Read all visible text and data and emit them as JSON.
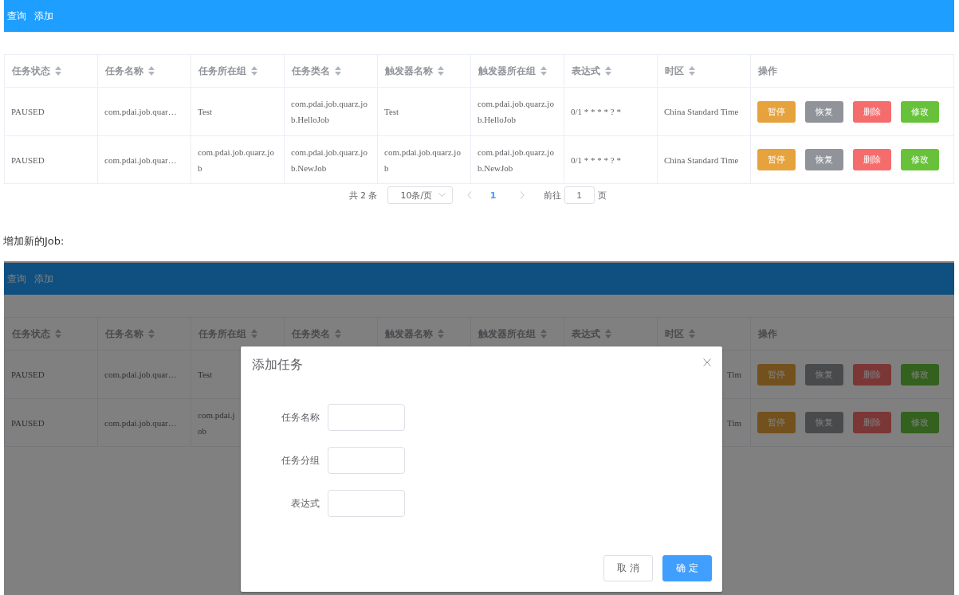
{
  "top_screen": {
    "nav": [
      {
        "label": "查询"
      },
      {
        "label": "添加"
      }
    ],
    "table": {
      "columns": [
        {
          "label": "任务状态",
          "sortable": true
        },
        {
          "label": "任务名称",
          "sortable": true
        },
        {
          "label": "任务所在组",
          "sortable": true
        },
        {
          "label": "任务类名",
          "sortable": true
        },
        {
          "label": "触发器名称",
          "sortable": true
        },
        {
          "label": "触发器所在组",
          "sortable": true
        },
        {
          "label": "表达式",
          "sortable": true
        },
        {
          "label": "时区",
          "sortable": true
        },
        {
          "label": "操作",
          "sortable": false
        }
      ],
      "rows": [
        {
          "cells": [
            "PAUSED",
            "com.pdai.job.quar…",
            "Test",
            "com.pdai.job.quarz.job.HelloJob",
            "Test",
            "com.pdai.job.quarz.job.HelloJob",
            "0/1 * * * * ? *",
            "China Standard Time"
          ],
          "actions": [
            {
              "label": "暂停",
              "kind": "warning"
            },
            {
              "label": "恢复",
              "kind": "info"
            },
            {
              "label": "删除",
              "kind": "danger"
            },
            {
              "label": "修改",
              "kind": "success"
            }
          ]
        },
        {
          "cells": [
            "PAUSED",
            "com.pdai.job.quar…",
            "com.pdai.job.quarz.job",
            "com.pdai.job.quarz.job.NewJob",
            "com.pdai.job.quarz.job",
            "com.pdai.job.quarz.job.NewJob",
            "0/1 * * * * ? *",
            "China Standard Time"
          ],
          "actions": [
            {
              "label": "暂停",
              "kind": "warning"
            },
            {
              "label": "恢复",
              "kind": "info"
            },
            {
              "label": "删除",
              "kind": "danger"
            },
            {
              "label": "修改",
              "kind": "success"
            }
          ]
        }
      ]
    },
    "pagination": {
      "total": "共 2 条",
      "page_size": "10条/页",
      "pages": [
        {
          "label": "1",
          "selected": true
        }
      ],
      "goto_label": "前往",
      "goto_value": "1",
      "goto_suffix": "页"
    }
  },
  "caption": "增加新的Job:",
  "bottom_screen": {
    "nav": [
      {
        "label": "查询"
      },
      {
        "label": "添加"
      }
    ],
    "table": {
      "columns": [
        {
          "label": "任务状态",
          "sortable": true
        },
        {
          "label": "任务名称",
          "sortable": true
        },
        {
          "label": "任务所在组",
          "sortable": true
        },
        {
          "label": "任务类名",
          "sortable": true
        },
        {
          "label": "触发器名称",
          "sortable": true
        },
        {
          "label": "触发器所在组",
          "sortable": true
        },
        {
          "label": "表达式",
          "sortable": true
        },
        {
          "label": "时区",
          "sortable": true
        },
        {
          "label": "操作",
          "sortable": false
        }
      ],
      "rows": [
        {
          "cells": [
            {
              "lines": [
                "PAUSED"
              ]
            },
            {
              "lines": [
                "com.pdai.job.quar…"
              ]
            },
            {
              "lines": [
                "Test"
              ]
            }
          ],
          "time_zone": "Tim",
          "actions": [
            {
              "label": "暂停",
              "kind": "warning"
            },
            {
              "label": "恢复",
              "kind": "info"
            },
            {
              "label": "删除",
              "kind": "danger"
            },
            {
              "label": "修改",
              "kind": "success"
            }
          ]
        },
        {
          "cells": [
            {
              "lines": [
                "PAUSED"
              ]
            },
            {
              "lines": [
                "com.pdai.job.quar…"
              ]
            },
            {
              "lines": [
                "com.pdai.j",
                "ob"
              ]
            }
          ],
          "time_zone": "Tim",
          "actions": [
            {
              "label": "暂停",
              "kind": "warning"
            },
            {
              "label": "恢复",
              "kind": "info"
            },
            {
              "label": "删除",
              "kind": "danger"
            },
            {
              "label": "修改",
              "kind": "success"
            }
          ]
        }
      ]
    },
    "dialog": {
      "title": "添加任务",
      "fields": [
        {
          "label": "任务名称"
        },
        {
          "label": "任务分组"
        },
        {
          "label": "表达式"
        }
      ],
      "buttons": [
        {
          "label": "取 消",
          "kind": "default"
        },
        {
          "label": "确 定",
          "kind": "primary"
        }
      ]
    }
  }
}
